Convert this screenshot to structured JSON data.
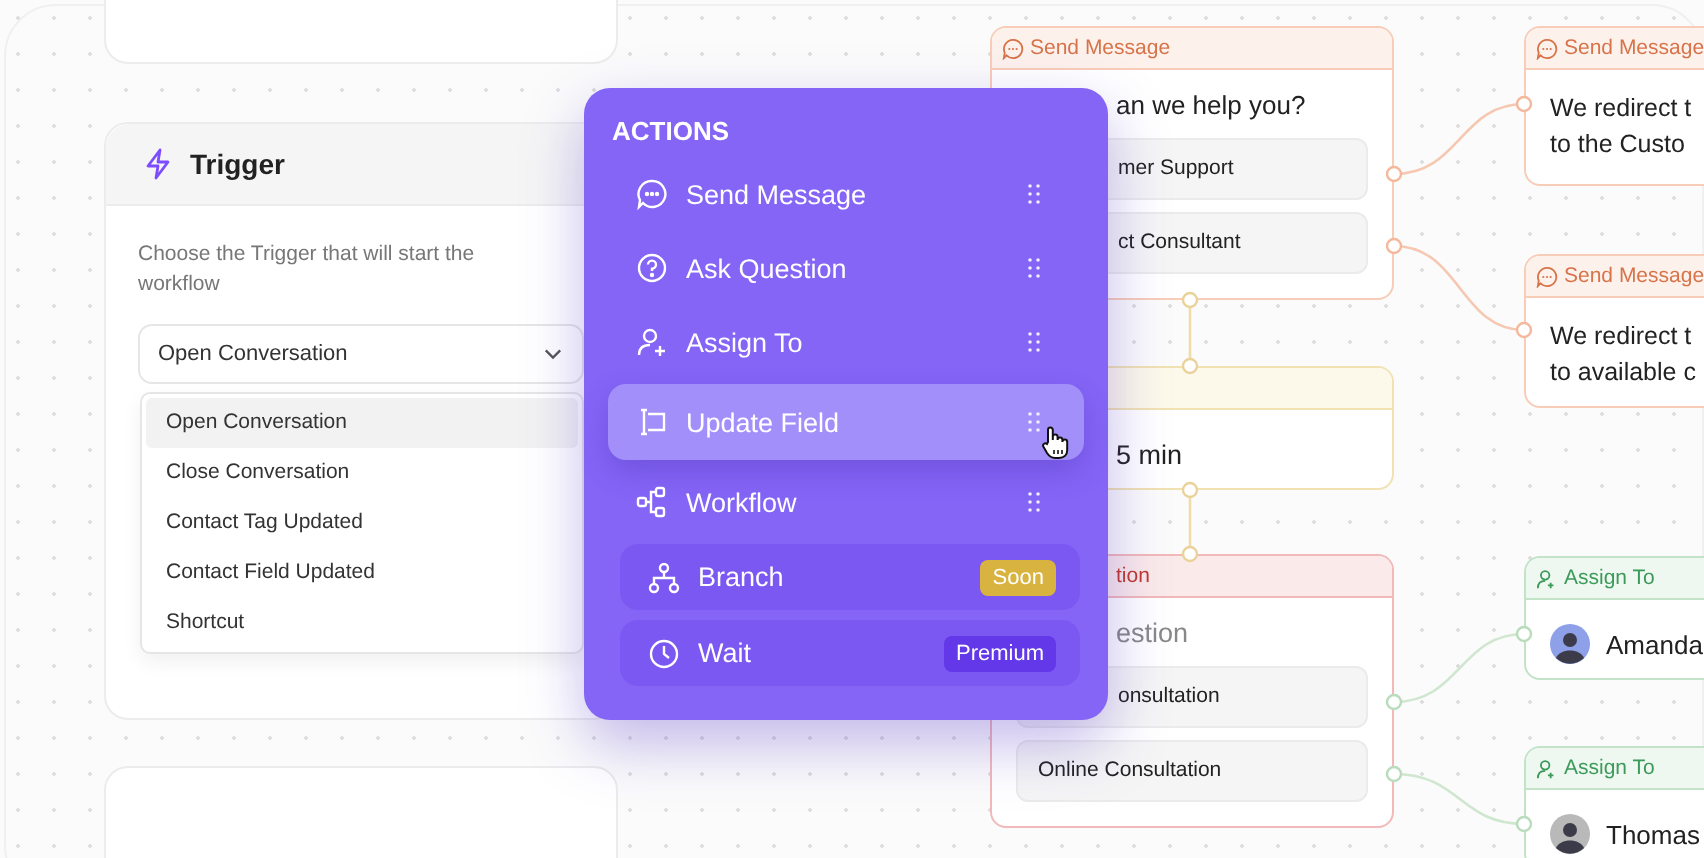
{
  "trigger_panel": {
    "title": "Trigger",
    "description": "Choose the Trigger that will start the workflow",
    "select": {
      "value": "Open Conversation"
    },
    "options": [
      {
        "label": "Open Conversation",
        "selected": true
      },
      {
        "label": "Close Conversation",
        "selected": false
      },
      {
        "label": "Contact Tag Updated",
        "selected": false
      },
      {
        "label": "Contact Field Updated",
        "selected": false
      },
      {
        "label": "Shortcut",
        "selected": false
      }
    ]
  },
  "actions_panel": {
    "title": "ACTIONS",
    "items": [
      {
        "label": "Send Message",
        "kind": "draggable",
        "selected": false
      },
      {
        "label": "Ask Question",
        "kind": "draggable",
        "selected": false
      },
      {
        "label": "Assign To",
        "kind": "draggable",
        "selected": false
      },
      {
        "label": "Update Field",
        "kind": "draggable",
        "selected": true
      },
      {
        "label": "Workflow",
        "kind": "draggable",
        "selected": false
      },
      {
        "label": "Branch",
        "kind": "locked",
        "selected": false,
        "badge": {
          "label": "Soon",
          "kind": "soon"
        }
      },
      {
        "label": "Wait",
        "kind": "locked",
        "selected": false,
        "badge": {
          "label": "Premium",
          "kind": "premium"
        }
      }
    ]
  },
  "flow_nodes": [
    {
      "kind": "send_message",
      "header": "Send Message",
      "question": "an we help you?",
      "options": [
        "mer Support",
        "ct Consultant"
      ]
    },
    {
      "kind": "wait",
      "lines": [
        "5 min"
      ]
    },
    {
      "kind": "ask_question",
      "header": "tion",
      "prompt": "estion",
      "options": [
        "onsultation",
        "Online Consultation"
      ]
    },
    {
      "kind": "send_message",
      "header": "Send Message",
      "lines": [
        "We redirect t",
        "to the Custo"
      ]
    },
    {
      "kind": "send_message",
      "header": "Send Message",
      "lines": [
        "We redirect t",
        "to available c"
      ]
    },
    {
      "kind": "assign",
      "header": "Assign To",
      "assignee": "Amanda"
    },
    {
      "kind": "assign",
      "header": "Assign To",
      "assignee": "Thomas"
    }
  ]
}
